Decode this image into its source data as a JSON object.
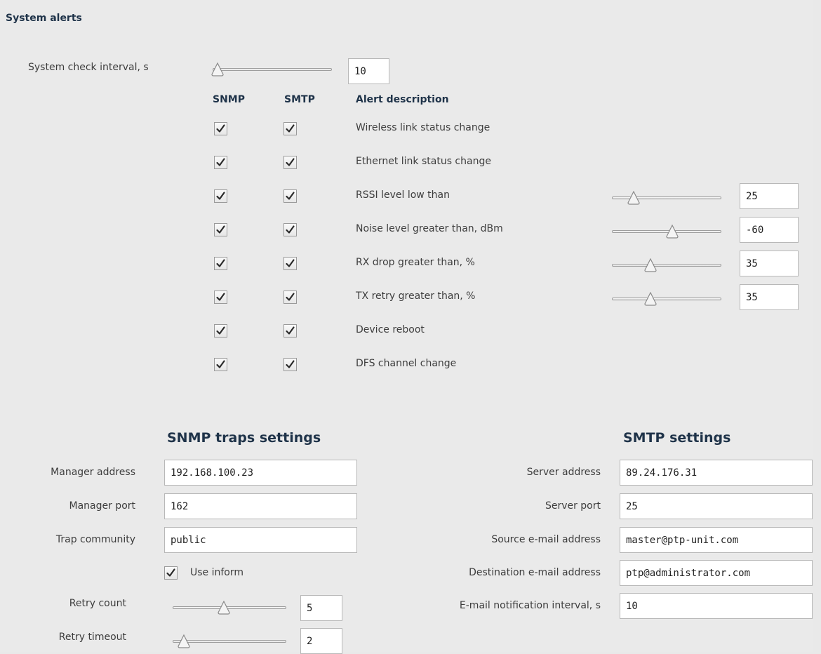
{
  "section_title": "System alerts",
  "check_interval": {
    "label": "System check interval, s",
    "value": "10",
    "slider_pct": 4
  },
  "columns": {
    "snmp": "SNMP",
    "smtp": "SMTP",
    "desc": "Alert description"
  },
  "alerts": [
    {
      "label": "Wireless link status change",
      "snmp": true,
      "smtp": true
    },
    {
      "label": "Ethernet link status change",
      "snmp": true,
      "smtp": true
    },
    {
      "label": "RSSI level low than",
      "snmp": true,
      "smtp": true,
      "value": "25",
      "slider_pct": 20
    },
    {
      "label": "Noise level greater than, dBm",
      "snmp": true,
      "smtp": true,
      "value": "-60",
      "slider_pct": 55
    },
    {
      "label": "RX drop greater than, %",
      "snmp": true,
      "smtp": true,
      "value": "35",
      "slider_pct": 35
    },
    {
      "label": "TX retry greater than, %",
      "snmp": true,
      "smtp": true,
      "value": "35",
      "slider_pct": 35
    },
    {
      "label": "Device reboot",
      "snmp": true,
      "smtp": true
    },
    {
      "label": "DFS channel change",
      "snmp": true,
      "smtp": true
    }
  ],
  "snmp": {
    "title": "SNMP traps settings",
    "manager_address": {
      "label": "Manager address",
      "value": "192.168.100.23"
    },
    "manager_port": {
      "label": "Manager port",
      "value": "162"
    },
    "trap_community": {
      "label": "Trap community",
      "value": "public"
    },
    "use_inform": {
      "label": "Use inform",
      "checked": true
    },
    "retry_count": {
      "label": "Retry count",
      "value": "5",
      "slider_pct": 45
    },
    "retry_timeout": {
      "label": "Retry timeout",
      "value": "2",
      "slider_pct": 10
    }
  },
  "smtp": {
    "title": "SMTP settings",
    "server_address": {
      "label": "Server address",
      "value": "89.24.176.31"
    },
    "server_port": {
      "label": "Server port",
      "value": "25"
    },
    "source_email": {
      "label": "Source e-mail address",
      "value": "master@ptp-unit.com"
    },
    "destination_email": {
      "label": "Destination e-mail address",
      "value": "ptp@administrator.com"
    },
    "notification_interval": {
      "label": "E-mail notification interval, s",
      "value": "10"
    }
  },
  "icons": {
    "checkbox": "checkmark-icon",
    "slider_thumb": "slider-thumb-icon"
  }
}
